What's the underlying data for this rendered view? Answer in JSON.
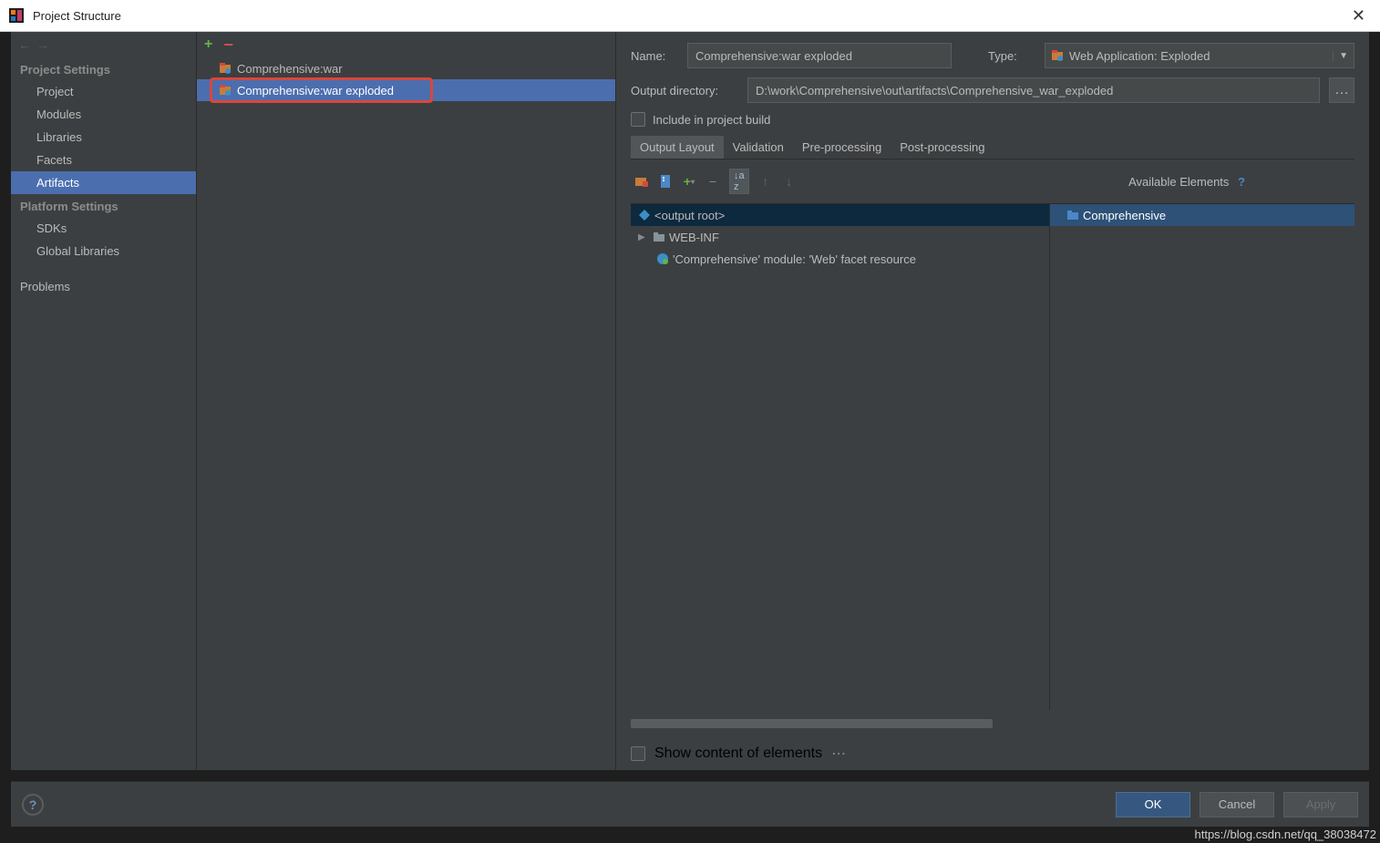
{
  "title": "Project Structure",
  "sidebar": {
    "project_heading": "Project Settings",
    "project_items": [
      "Project",
      "Modules",
      "Libraries",
      "Facets",
      "Artifacts"
    ],
    "selected_project_index": 4,
    "platform_heading": "Platform Settings",
    "platform_items": [
      "SDKs",
      "Global Libraries"
    ],
    "problems": "Problems"
  },
  "artifact_list": {
    "items": [
      "Comprehensive:war",
      "Comprehensive:war exploded"
    ],
    "selected_index": 1
  },
  "form": {
    "name_label": "Name:",
    "name_value": "Comprehensive:war exploded",
    "type_label": "Type:",
    "type_value": "Web Application: Exploded",
    "output_label": "Output directory:",
    "output_value": "D:\\work\\Comprehensive\\out\\artifacts\\Comprehensive_war_exploded",
    "include_label": "Include in project build"
  },
  "tabs": [
    "Output Layout",
    "Validation",
    "Pre-processing",
    "Post-processing"
  ],
  "active_tab": 0,
  "available_label": "Available Elements",
  "tree": {
    "root": "<output root>",
    "webinf": "WEB-INF",
    "facet": "'Comprehensive' module: 'Web' facet resource",
    "avail_item": "Comprehensive"
  },
  "show_content": "Show content of elements",
  "buttons": {
    "ok": "OK",
    "cancel": "Cancel",
    "apply": "Apply"
  },
  "watermark": "https://blog.csdn.net/qq_38038472"
}
